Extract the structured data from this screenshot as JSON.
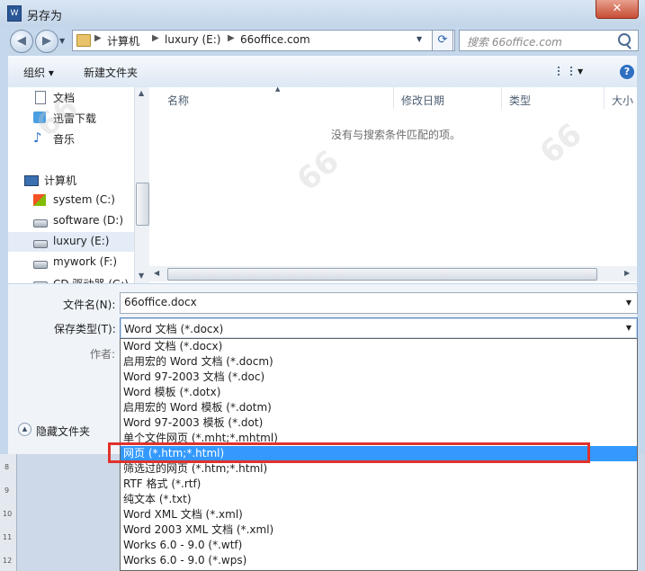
{
  "window": {
    "title": "另存为",
    "icon_text": "W",
    "close_label": "✕"
  },
  "nav": {
    "path": [
      "计算机",
      "luxury (E:)",
      "66office.com"
    ],
    "search_placeholder": "搜索 66office.com"
  },
  "toolbar": {
    "organize": "组织 ▾",
    "new_folder": "新建文件夹"
  },
  "sidebar": {
    "items": [
      {
        "label": "文档",
        "icon": "document-icon"
      },
      {
        "label": "迅雷下载",
        "icon": "thunder-download-icon"
      },
      {
        "label": "音乐",
        "icon": "music-icon"
      },
      {
        "label": "计算机",
        "icon": "computer-icon"
      },
      {
        "label": "system (C:)",
        "icon": "system-drive-icon"
      },
      {
        "label": "software (D:)",
        "icon": "drive-icon"
      },
      {
        "label": "luxury (E:)",
        "icon": "drive-icon"
      },
      {
        "label": "mywork (F:)",
        "icon": "drive-icon"
      },
      {
        "label": "CD 驱动器 (G:)",
        "icon": "cd-drive-icon"
      }
    ]
  },
  "filelist": {
    "columns": [
      "名称",
      "修改日期",
      "类型",
      "大小"
    ],
    "empty_message": "没有与搜索条件匹配的项。"
  },
  "form": {
    "filename_label": "文件名(N):",
    "filename_value": "66office.docx",
    "filetype_label": "保存类型(T):",
    "filetype_value": "Word 文档 (*.docx)",
    "author_label": "作者:",
    "hide_folders": "隐藏文件夹"
  },
  "filetype_options": [
    "Word 文档 (*.docx)",
    "启用宏的 Word 文档 (*.docm)",
    "Word 97-2003 文档 (*.doc)",
    "Word 模板 (*.dotx)",
    "启用宏的 Word 模板 (*.dotm)",
    "Word 97-2003 模板 (*.dot)",
    "单个文件网页 (*.mht;*.mhtml)",
    "网页 (*.htm;*.html)",
    "筛选过的网页 (*.htm;*.html)",
    "RTF 格式 (*.rtf)",
    "纯文本 (*.txt)",
    "Word XML 文档 (*.xml)",
    "Word 2003 XML 文档 (*.xml)",
    "Works 6.0 - 9.0 (*.wtf)",
    "Works 6.0 - 9.0 (*.wps)"
  ],
  "selected_option_index": 7,
  "ruler_marks": [
    "8",
    "9",
    "10",
    "11",
    "12"
  ],
  "colors": {
    "selection": "#3399ff",
    "highlight_box": "#e0322c",
    "frame": "#c5d7ea"
  }
}
